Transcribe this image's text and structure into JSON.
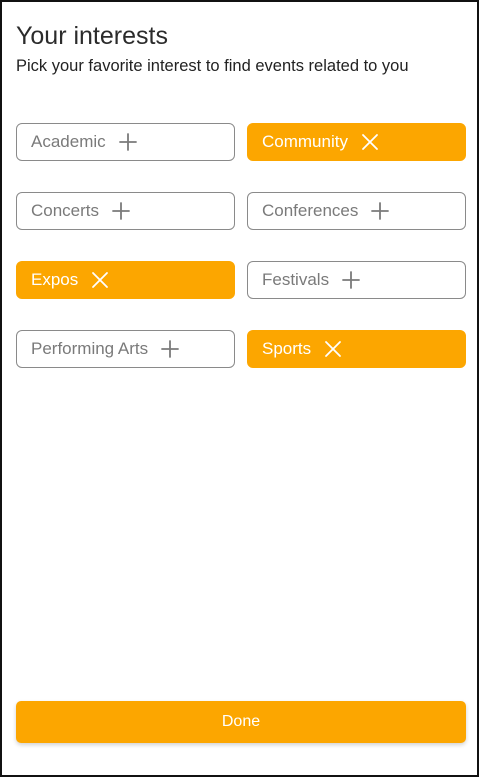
{
  "header": {
    "title": "Your interests",
    "subtitle": "Pick your favorite interest to find events related to you"
  },
  "interests": [
    {
      "label": "Academic",
      "selected": false
    },
    {
      "label": "Community",
      "selected": true
    },
    {
      "label": "Concerts",
      "selected": false
    },
    {
      "label": "Conferences",
      "selected": false
    },
    {
      "label": "Expos",
      "selected": true
    },
    {
      "label": "Festivals",
      "selected": false
    },
    {
      "label": "Performing Arts",
      "selected": false
    },
    {
      "label": "Sports",
      "selected": true
    }
  ],
  "footer": {
    "done_label": "Done"
  },
  "colors": {
    "accent": "#fca600",
    "chip_border": "#8a8a8a",
    "chip_text": "#7a7a7a"
  }
}
